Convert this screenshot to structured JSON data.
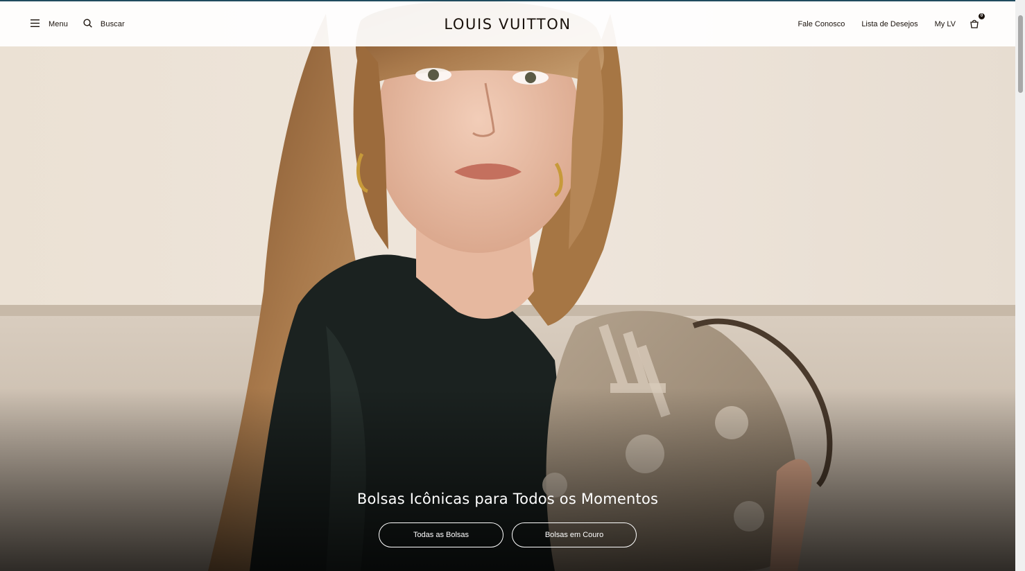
{
  "header": {
    "menu_label": "Menu",
    "search_label": "Buscar",
    "logo": "LOUIS VUITTON",
    "links": [
      "Fale Conosco",
      "Lista de Desejos",
      "My LV"
    ],
    "bag_count": "0"
  },
  "hero": {
    "title": "Bolsas Icônicas para Todos os Momentos",
    "buttons": [
      "Todas as Bolsas",
      "Bolsas em Couro"
    ]
  },
  "icons": {
    "menu": "hamburger-icon",
    "search": "search-icon",
    "bag": "shopping-bag-icon"
  },
  "colors": {
    "text": "#19110b",
    "accent_bar": "#1f4b5e",
    "hero_wall": "#e9e0d4",
    "hero_text": "#ffffff"
  }
}
